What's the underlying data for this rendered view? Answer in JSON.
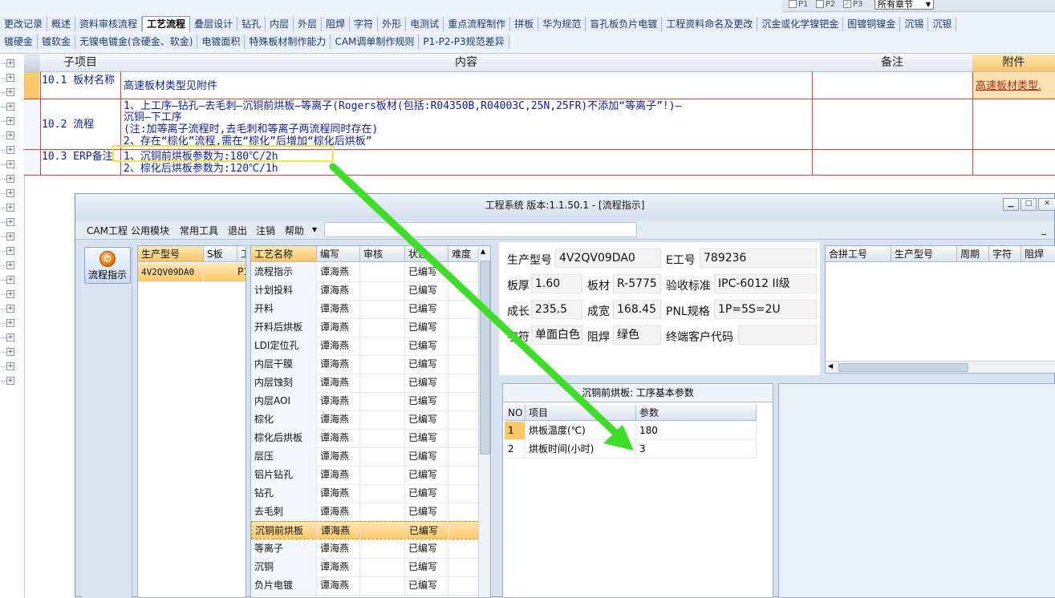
{
  "top_right": {
    "checks": [
      {
        "label": "P1",
        "checked": false
      },
      {
        "label": "P2",
        "checked": false
      },
      {
        "label": "P3",
        "checked": true
      }
    ],
    "chapter_select": "所有章节"
  },
  "tabs_row1": [
    "更改记录",
    "概述",
    "资料审核流程",
    "工艺流程",
    "叠层设计",
    "钻孔",
    "内层",
    "外层",
    "阻焊",
    "字符",
    "外形",
    "电测试",
    "重点流程制作",
    "拼板",
    "华为规范",
    "盲孔板负片电镀",
    "工程资料命名及更改",
    "沉金或化学镍钯金",
    "图镀铜镍金",
    "沉锡",
    "沉银"
  ],
  "tabs_row1_active": "工艺流程",
  "tabs_row2": [
    "镀硬金",
    "镀软金",
    "无镍电镀金(含硬金、软金)",
    "电镀面积",
    "特殊板材制作能力",
    "CAM调单制作规则",
    "P1-P2-P3规范差异"
  ],
  "grid": {
    "headers": [
      "子项目",
      "内容",
      "备注",
      "附件"
    ],
    "rows": [
      {
        "sub": "10.1 板材名称",
        "content": [
          "高速板材类型见附件"
        ],
        "note": "",
        "attachment": "高速板材类型."
      },
      {
        "sub": "10.2 流程",
        "content": [
          "1、上工序—钻孔—去毛刺—沉铜前烘板—等离子(Rogers板材(包括:R04350B,R04003C,25N,25FR)不添加“等离子”!)—",
          "沉铜—下工序",
          "(注:加等离子流程时,去毛刺和等离子两流程同时存在)",
          "2、存在“棕化”流程,需在“棕化”后增加“棕化后烘板”"
        ],
        "note": "",
        "attachment": ""
      },
      {
        "sub": "10.3 ERP备注",
        "content": [
          "1、沉铜前烘板参数为:180℃/2h",
          "2、棕化后烘板参数为:120℃/1h"
        ],
        "note": "",
        "attachment": ""
      }
    ]
  },
  "window": {
    "title": "工程系统  版本:1.1.50.1 - [流程指示]",
    "menu": [
      "CAM工程",
      "公用模块",
      "常用工具",
      "退出",
      "注销",
      "帮助"
    ],
    "sidebar_button": "流程指示",
    "model_grid": {
      "headers": [
        "生产型号",
        "S板",
        "工"
      ],
      "rows": [
        [
          "4V2QV09DA0",
          "",
          "P1"
        ]
      ]
    },
    "process_grid": {
      "headers": [
        "工艺名称",
        "编写",
        "审核",
        "状态",
        "难度"
      ],
      "rows": [
        [
          "流程指示",
          "谭海燕",
          "",
          "已编写",
          ""
        ],
        [
          "计划投料",
          "谭海燕",
          "",
          "已编写",
          ""
        ],
        [
          "开料",
          "谭海燕",
          "",
          "已编写",
          ""
        ],
        [
          "开料后烘板",
          "谭海燕",
          "",
          "已编写",
          ""
        ],
        [
          "LDI定位孔",
          "谭海燕",
          "",
          "已编写",
          ""
        ],
        [
          "内层干膜",
          "谭海燕",
          "",
          "已编写",
          ""
        ],
        [
          "内层蚀刻",
          "谭海燕",
          "",
          "已编写",
          ""
        ],
        [
          "内层AOI",
          "谭海燕",
          "",
          "已编写",
          ""
        ],
        [
          "棕化",
          "谭海燕",
          "",
          "已编写",
          ""
        ],
        [
          "棕化后烘板",
          "谭海燕",
          "",
          "已编写",
          ""
        ],
        [
          "层压",
          "谭海燕",
          "",
          "已编写",
          ""
        ],
        [
          "铝片钻孔",
          "谭海燕",
          "",
          "已编写",
          ""
        ],
        [
          "钻孔",
          "谭海燕",
          "",
          "已编写",
          ""
        ],
        [
          "去毛刺",
          "谭海燕",
          "",
          "已编写",
          ""
        ],
        [
          "沉铜前烘板",
          "谭海燕",
          "",
          "已编写",
          ""
        ],
        [
          "等离子",
          "谭海燕",
          "",
          "已编写",
          ""
        ],
        [
          "沉铜",
          "谭海燕",
          "",
          "已编写",
          ""
        ],
        [
          "负片电镀",
          "谭海燕",
          "",
          "已编写",
          ""
        ]
      ],
      "selected_index": 14
    },
    "info": {
      "model_label": "生产型号",
      "model": "4V2QV09DA0",
      "e_label": "E工号",
      "e_no": "789236",
      "thickness_label": "板厚",
      "thickness": "1.60",
      "material_label": "板材",
      "material": "R-5775",
      "standard_label": "验收标准",
      "standard": "IPC-6012 II级",
      "length_label": "成长",
      "length": "235.5",
      "width_label": "成宽",
      "width": "168.45",
      "pnl_label": "PNL规格",
      "pnl": "1P=5S=2U",
      "char_label": "字符",
      "char": "单面白色",
      "mask_label": "阻焊",
      "mask": "绿色",
      "customer_label": "终端客户代码",
      "customer": ""
    },
    "combo_grid": {
      "headers": [
        "合拼工号",
        "生产型号",
        "周期",
        "字符",
        "阻焊"
      ]
    },
    "param_panel": {
      "title": "沉铜前烘板: 工序基本参数",
      "headers": [
        "NO",
        "项目",
        "参数"
      ],
      "rows": [
        [
          "1",
          "烘板温度(℃)",
          "180"
        ],
        [
          "2",
          "烘板时间(小时)",
          "3"
        ]
      ]
    }
  },
  "colors": {
    "highlight_box": "#f2e04c",
    "arrow": "#3fdc2a",
    "grid_line": "#d0463a",
    "content_text": "#0b1f8f",
    "attachment_bg": "#fde3b3",
    "selected_row": "#fbc868"
  }
}
